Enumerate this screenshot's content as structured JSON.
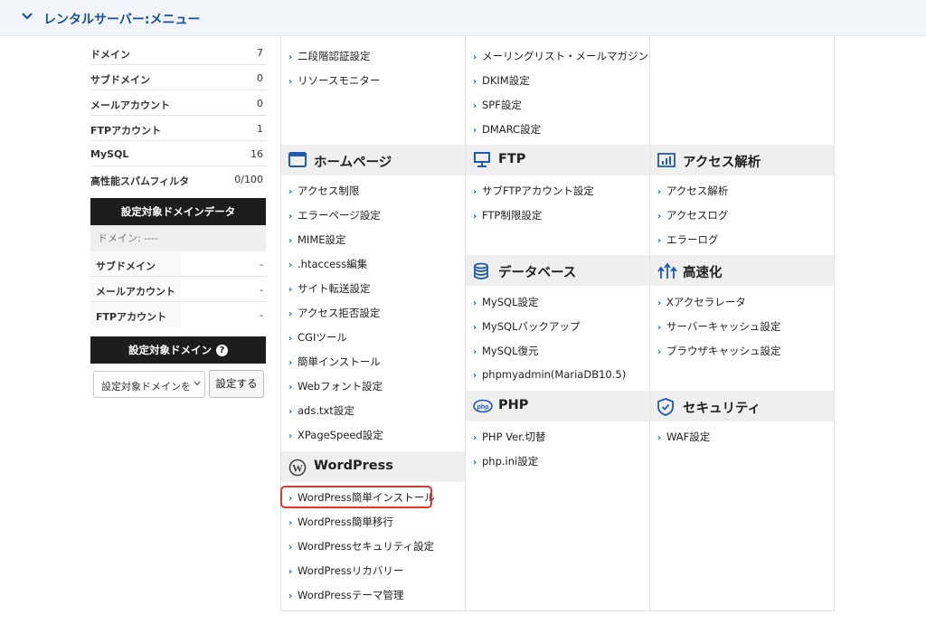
{
  "header": {
    "title": "レンタルサーバー:メニュー"
  },
  "stats": [
    {
      "label": "ドメイン",
      "value": "7"
    },
    {
      "label": "サブドメイン",
      "value": "0"
    },
    {
      "label": "メールアカウント",
      "value": "0"
    },
    {
      "label": "FTPアカウント",
      "value": "1"
    },
    {
      "label": "MySQL",
      "value": "16"
    },
    {
      "label": "高性能スパムフィルタ",
      "value": "0/100"
    }
  ],
  "domain_data": {
    "title": "設定対象ドメインデータ",
    "domain_line": "ドメイン: ----",
    "rows": [
      {
        "label": "サブドメイン",
        "value": "-"
      },
      {
        "label": "メールアカウント",
        "value": "-"
      },
      {
        "label": "FTPアカウント",
        "value": "-"
      }
    ]
  },
  "target_domain": {
    "title": "設定対象ドメイン",
    "select_value": "設定対象ドメインを",
    "button": "設定する"
  },
  "col1": {
    "top_links": [
      "二段階認証設定",
      "リソースモニター"
    ],
    "homepage": {
      "title": "ホームページ",
      "links": [
        "アクセス制限",
        "エラーページ設定",
        "MIME設定",
        ".htaccess編集",
        "サイト転送設定",
        "アクセス拒否設定",
        "CGIツール",
        "簡単インストール",
        "Webフォント設定",
        "ads.txt設定",
        "XPageSpeed設定"
      ]
    },
    "wordpress": {
      "title": "WordPress",
      "links": [
        "WordPress簡単インストール",
        "WordPress簡単移行",
        "WordPressセキュリティ設定",
        "WordPressリカバリー",
        "WordPressテーマ管理"
      ]
    }
  },
  "col2": {
    "top_links": [
      "メーリングリスト・メールマガジン",
      "DKIM設定",
      "SPF設定",
      "DMARC設定"
    ],
    "ftp": {
      "title": "FTP",
      "links": [
        "サブFTPアカウント設定",
        "FTP制限設定"
      ]
    },
    "database": {
      "title": "データベース",
      "links": [
        "MySQL設定",
        "MySQLバックアップ",
        "MySQL復元",
        "phpmyadmin(MariaDB10.5)"
      ]
    },
    "php": {
      "title": "PHP",
      "links": [
        "PHP Ver.切替",
        "php.ini設定"
      ]
    }
  },
  "col3": {
    "access": {
      "title": "アクセス解析",
      "links": [
        "アクセス解析",
        "アクセスログ",
        "エラーログ"
      ]
    },
    "speed": {
      "title": "高速化",
      "links": [
        "Xアクセラレータ",
        "サーバーキャッシュ設定",
        "ブラウザキャッシュ設定"
      ]
    },
    "security": {
      "title": "セキュリティ",
      "links": [
        "WAF設定"
      ]
    }
  },
  "colors": {
    "accent": "#1a4f9c",
    "highlight": "#e8322a",
    "header_bg": "#f1f5fa",
    "bar_bg": "#1d1d1d"
  },
  "icons": [
    "chevron-down-icon",
    "window-icon",
    "wordpress-icon",
    "monitor-icon",
    "database-icon",
    "php-icon",
    "bar-chart-icon",
    "speed-arrows-icon",
    "shield-icon",
    "help-icon"
  ]
}
